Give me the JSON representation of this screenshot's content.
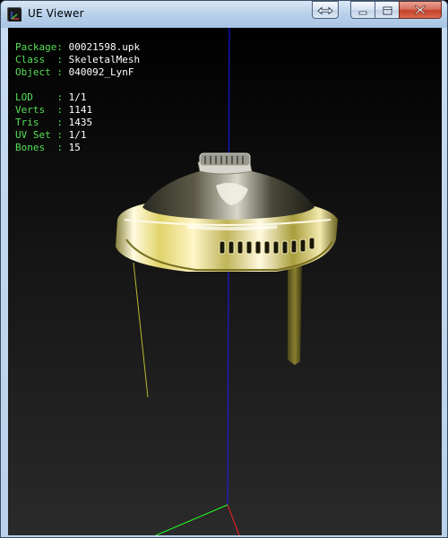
{
  "window": {
    "title": "UE Viewer",
    "buttons": {
      "extra_icon": "swap-arrows-icon",
      "minimize_icon": "minimize-icon",
      "maximize_icon": "maximize-icon",
      "close_icon": "close-icon"
    }
  },
  "info_panel": {
    "group1": [
      {
        "key": "Package: ",
        "value": "00021598.upk"
      },
      {
        "key": "Class  : ",
        "value": "SkeletalMesh"
      },
      {
        "key": "Object : ",
        "value": "040092_LynF"
      }
    ],
    "group2": [
      {
        "key": "LOD    : ",
        "value": "1/1"
      },
      {
        "key": "Verts  : ",
        "value": "1141"
      },
      {
        "key": "Tris   : ",
        "value": "1435"
      },
      {
        "key": "UV Set : ",
        "value": "1/1"
      },
      {
        "key": "Bones  : ",
        "value": "15"
      }
    ]
  },
  "colors": {
    "label_green": "#55e055",
    "value_white": "#ffffff",
    "axis_blue": "#1a1aff",
    "axis_red": "#ff2020",
    "axis_green": "#20ff20",
    "bone_yellow": "#b8b830"
  }
}
